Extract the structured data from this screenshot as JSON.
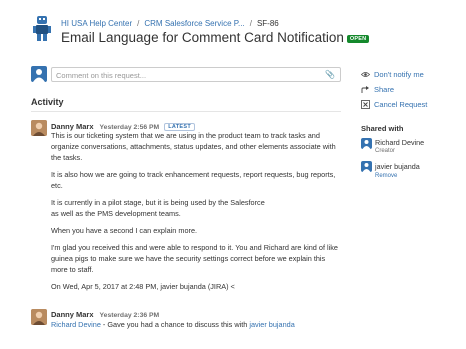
{
  "breadcrumb": {
    "items": [
      "HI USA Help Center",
      "CRM Salesforce Service P...",
      "SF-86"
    ]
  },
  "request": {
    "title": "Email Language for Comment Card Notification",
    "status_badge": "OPEN"
  },
  "comment_box": {
    "placeholder": "Comment on this request..."
  },
  "activity": {
    "heading": "Activity",
    "entries": [
      {
        "author": "Danny Marx",
        "time": "Yesterday 2:56 PM",
        "badge": "LATEST",
        "paragraphs": [
          "This is our ticketing system that we are using in the product team to track tasks and organize conversations, attachments, status updates, and other elements associate with the tasks.",
          "It is also how we are going to track enhancement requests, report requests, bug reports, etc.",
          "It is currently in a pilot stage, but it is being used by the Salesforce as well as the PMS development teams.",
          "When you have a second I can explain more.",
          "I'm glad you received this and were able to respond to it. You and Richard are kind of like guinea pigs to make sure we have the security settings correct before we explain this more to staff.",
          "On Wed, Apr 5, 2017 at 2:48 PM, javier bujanda (JIRA) <"
        ]
      },
      {
        "author": "Danny Marx",
        "time": "Yesterday 2:36 PM",
        "mention1": "Richard Devine",
        "text": " - Gave you had a chance to discuss this with ",
        "mention2": "javier bujanda"
      }
    ]
  },
  "sidebar": {
    "actions": [
      {
        "label": "Don't notify me",
        "icon": "eye-icon"
      },
      {
        "label": "Share",
        "icon": "share-icon"
      },
      {
        "label": "Cancel Request",
        "icon": "cancel-icon"
      }
    ],
    "shared_with": {
      "heading": "Shared with",
      "users": [
        {
          "name": "Richard Devine",
          "role": "Creator"
        },
        {
          "name": "javier bujanda",
          "action": "Remove"
        }
      ]
    }
  }
}
